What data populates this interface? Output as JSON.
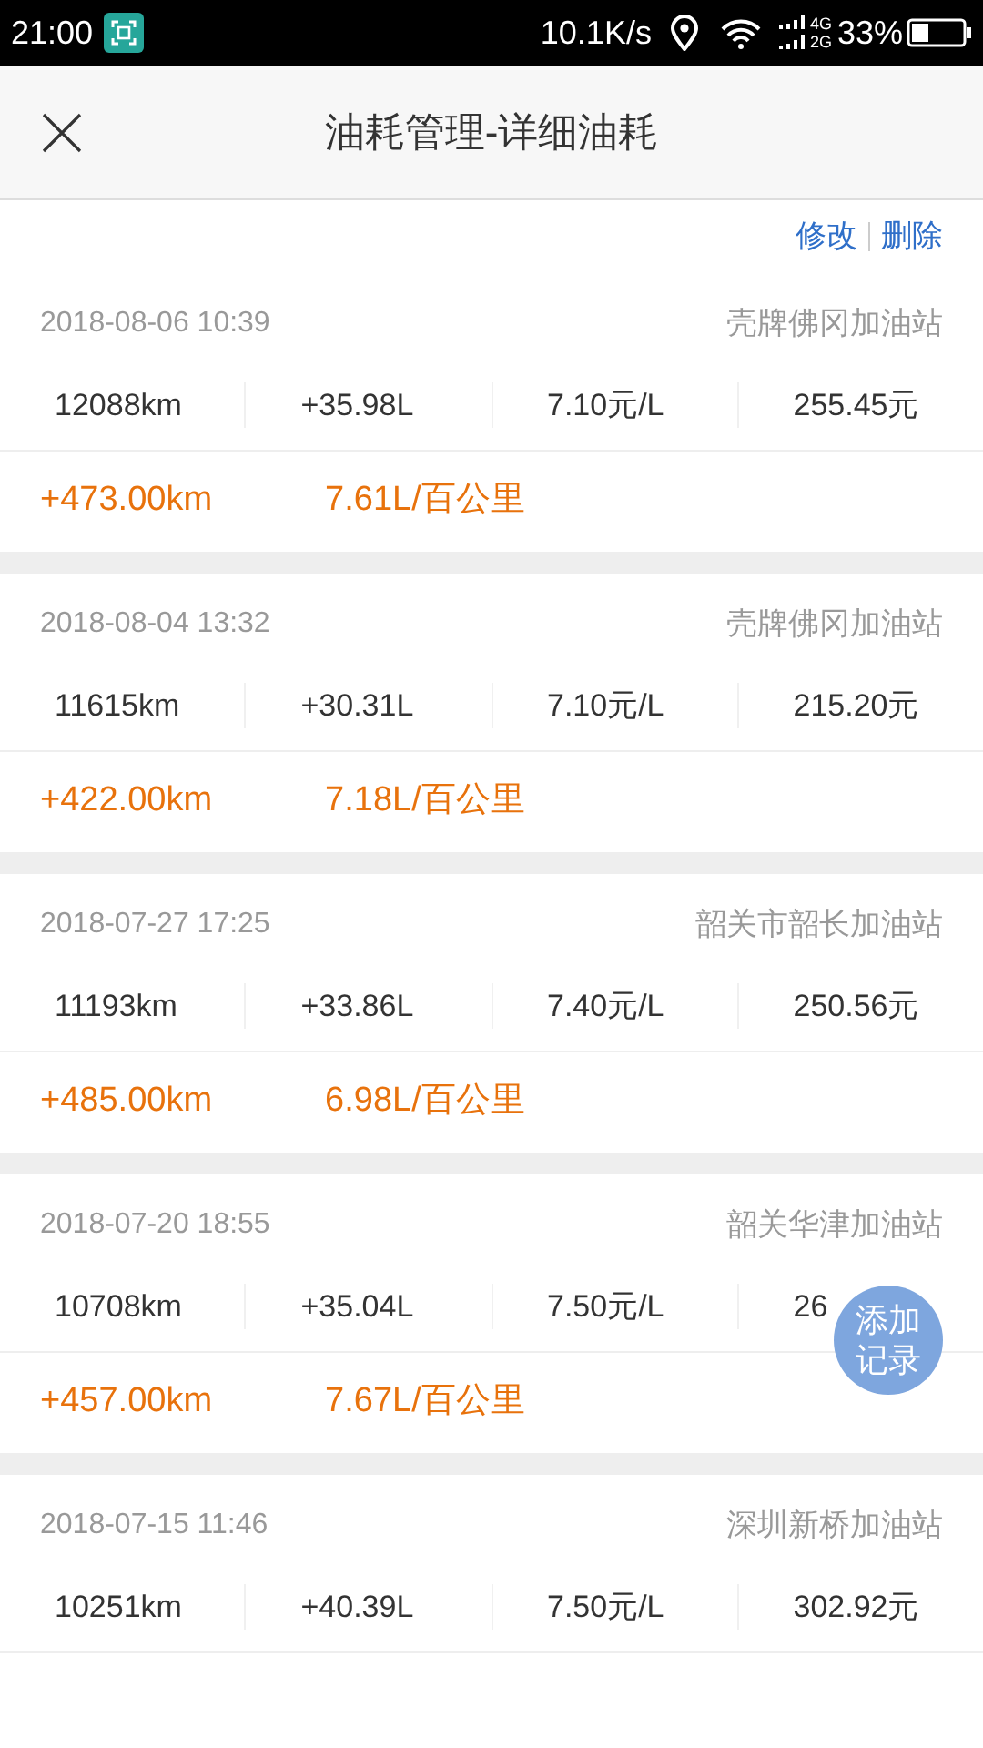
{
  "status_bar": {
    "time": "21:00",
    "speed": "10.1K/s",
    "network_top": "4G",
    "network_bottom": "2G",
    "battery": "33%"
  },
  "header": {
    "title": "油耗管理-详细油耗"
  },
  "actions": [
    "修改",
    "删除"
  ],
  "records": [
    {
      "datetime": "2018-08-06 10:39",
      "station": "壳牌佛冈加油站",
      "cells": [
        "12088km",
        "+35.98L",
        "7.10元/L",
        "255.45元"
      ],
      "distance": "+473.00km",
      "consumption": "7.61L/百公里"
    },
    {
      "datetime": "2018-08-04 13:32",
      "station": "壳牌佛冈加油站",
      "cells": [
        "11615km",
        "+30.31L",
        "7.10元/L",
        "215.20元"
      ],
      "distance": "+422.00km",
      "consumption": "7.18L/百公里"
    },
    {
      "datetime": "2018-07-27 17:25",
      "station": "韶关市韶长加油站",
      "cells": [
        "11193km",
        "+33.86L",
        "7.40元/L",
        "250.56元"
      ],
      "distance": "+485.00km",
      "consumption": "6.98L/百公里"
    },
    {
      "datetime": "2018-07-20 18:55",
      "station": "韶关华津加油站",
      "cells": [
        "10708km",
        "+35.04L",
        "7.50元/L",
        "26"
      ],
      "distance": "+457.00km",
      "consumption": "7.67L/百公里"
    },
    {
      "datetime": "2018-07-15 11:46",
      "station": "深圳新桥加油站",
      "cells": [
        "10251km",
        "+40.39L",
        "7.50元/L",
        "302.92元"
      ]
    }
  ],
  "fab": {
    "label": "添加记录"
  }
}
